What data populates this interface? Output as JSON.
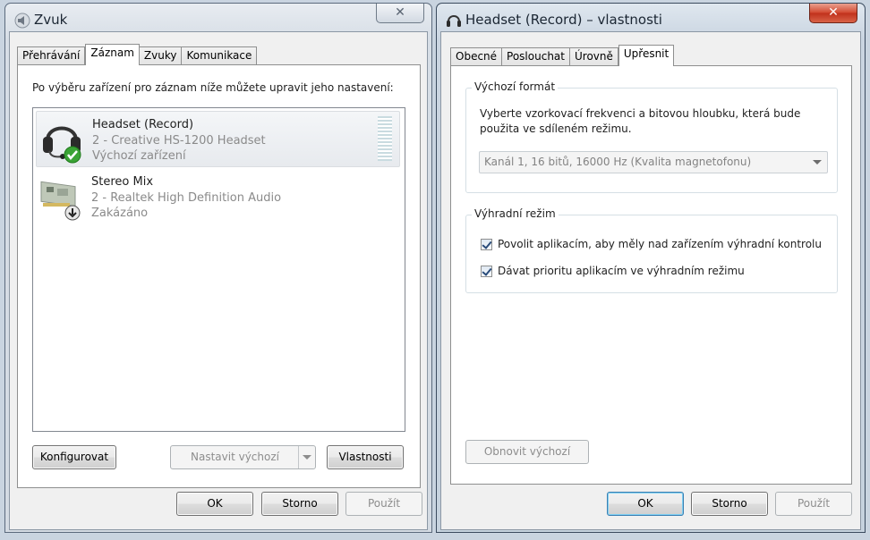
{
  "sound_window": {
    "title": "Zvuk",
    "close_label": "✕",
    "tabs": [
      {
        "label": "Přehrávání",
        "active": false
      },
      {
        "label": "Záznam",
        "active": true
      },
      {
        "label": "Zvuky",
        "active": false
      },
      {
        "label": "Komunikace",
        "active": false
      }
    ],
    "instruction": "Po výběru zařízení pro záznam níže můžete upravit jeho nastavení:",
    "devices": [
      {
        "name": "Headset (Record)",
        "description": "2 - Creative HS-1200 Headset",
        "status": "Výchozí zařízení",
        "icon": "headset-icon",
        "badge": "check-badge-icon",
        "selected": true
      },
      {
        "name": "Stereo Mix",
        "description": "2 - Realtek High Definition Audio",
        "status": "Zakázáno",
        "icon": "sound-card-icon",
        "badge": "disabled-arrow-badge-icon",
        "selected": false
      }
    ],
    "buttons": {
      "configure": "Konfigurovat",
      "set_default": "Nastavit výchozí",
      "properties": "Vlastnosti",
      "ok": "OK",
      "cancel": "Storno",
      "apply": "Použít"
    }
  },
  "props_window": {
    "title": "Headset (Record) – vlastnosti",
    "close_label": "✕",
    "tabs": [
      {
        "label": "Obecné",
        "active": false
      },
      {
        "label": "Poslouchat",
        "active": false
      },
      {
        "label": "Úrovně",
        "active": false
      },
      {
        "label": "Upřesnit",
        "active": true
      }
    ],
    "default_format": {
      "group_title": "Výchozí formát",
      "description_line1": "Vyberte vzorkovací frekvenci a bitovou hloubku, která bude",
      "description_line2": "použita ve sdíleném režimu.",
      "selected_format": "Kanál 1, 16 bitů, 16000 Hz (Kvalita magnetofonu)"
    },
    "exclusive_mode": {
      "group_title": "Výhradní režim",
      "options": [
        {
          "label": "Povolit aplikacím, aby měly nad zařízením výhradní kontrolu",
          "checked": true
        },
        {
          "label": "Dávat prioritu aplikacím ve výhradním režimu",
          "checked": true
        }
      ]
    },
    "buttons": {
      "restore_defaults": "Obnovit výchozí",
      "ok": "OK",
      "cancel": "Storno",
      "apply": "Použít"
    }
  },
  "colors": {
    "accent_selection": "#e7eaee",
    "check_green": "#3aa335",
    "close_red": "#c0301b"
  }
}
